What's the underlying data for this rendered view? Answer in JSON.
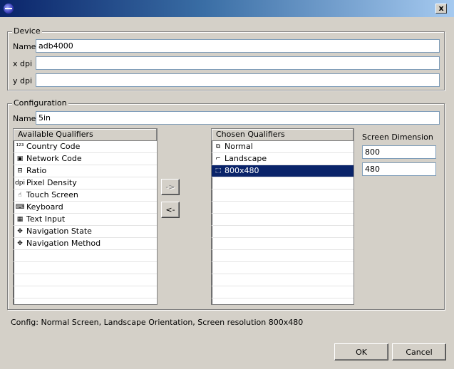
{
  "window": {
    "title": "",
    "close_glyph": "x"
  },
  "device": {
    "legend": "Device",
    "fields": [
      {
        "label": "Name",
        "value": "adb4000"
      },
      {
        "label": "x dpi",
        "value": ""
      },
      {
        "label": "y dpi",
        "value": ""
      }
    ]
  },
  "configuration": {
    "legend": "Configuration",
    "name_label": "Name",
    "name_value": "5in",
    "available": {
      "header": "Available Qualifiers",
      "items": [
        {
          "label": "Country Code",
          "icon": "country-code-icon",
          "glyph": "¹²³"
        },
        {
          "label": "Network Code",
          "icon": "network-code-icon",
          "glyph": "▣"
        },
        {
          "label": "Ratio",
          "icon": "ratio-icon",
          "glyph": "⊟"
        },
        {
          "label": "Pixel Density",
          "icon": "pixel-density-icon",
          "glyph": "dpi"
        },
        {
          "label": "Touch Screen",
          "icon": "touch-screen-icon",
          "glyph": "☝"
        },
        {
          "label": "Keyboard",
          "icon": "keyboard-icon",
          "glyph": "⌨"
        },
        {
          "label": "Text Input",
          "icon": "text-input-icon",
          "glyph": "▦"
        },
        {
          "label": "Navigation State",
          "icon": "navigation-state-icon",
          "glyph": "✥"
        },
        {
          "label": "Navigation Method",
          "icon": "navigation-method-icon",
          "glyph": "✥"
        }
      ]
    },
    "add_button": "->",
    "remove_button": "<-",
    "chosen": {
      "header": "Chosen Qualifiers",
      "items": [
        {
          "label": "Normal",
          "icon": "normal-screen-icon",
          "glyph": "⧉",
          "selected": false
        },
        {
          "label": "Landscape",
          "icon": "landscape-icon",
          "glyph": "⌐",
          "selected": false
        },
        {
          "label": "800x480",
          "icon": "screen-dimension-icon",
          "glyph": "⬚",
          "selected": true
        }
      ]
    },
    "dimension": {
      "label": "Screen Dimension",
      "width": "800",
      "height": "480"
    }
  },
  "config_summary": "Config: Normal Screen, Landscape Orientation, Screen resolution 800x480",
  "buttons": {
    "ok": "OK",
    "cancel": "Cancel"
  }
}
